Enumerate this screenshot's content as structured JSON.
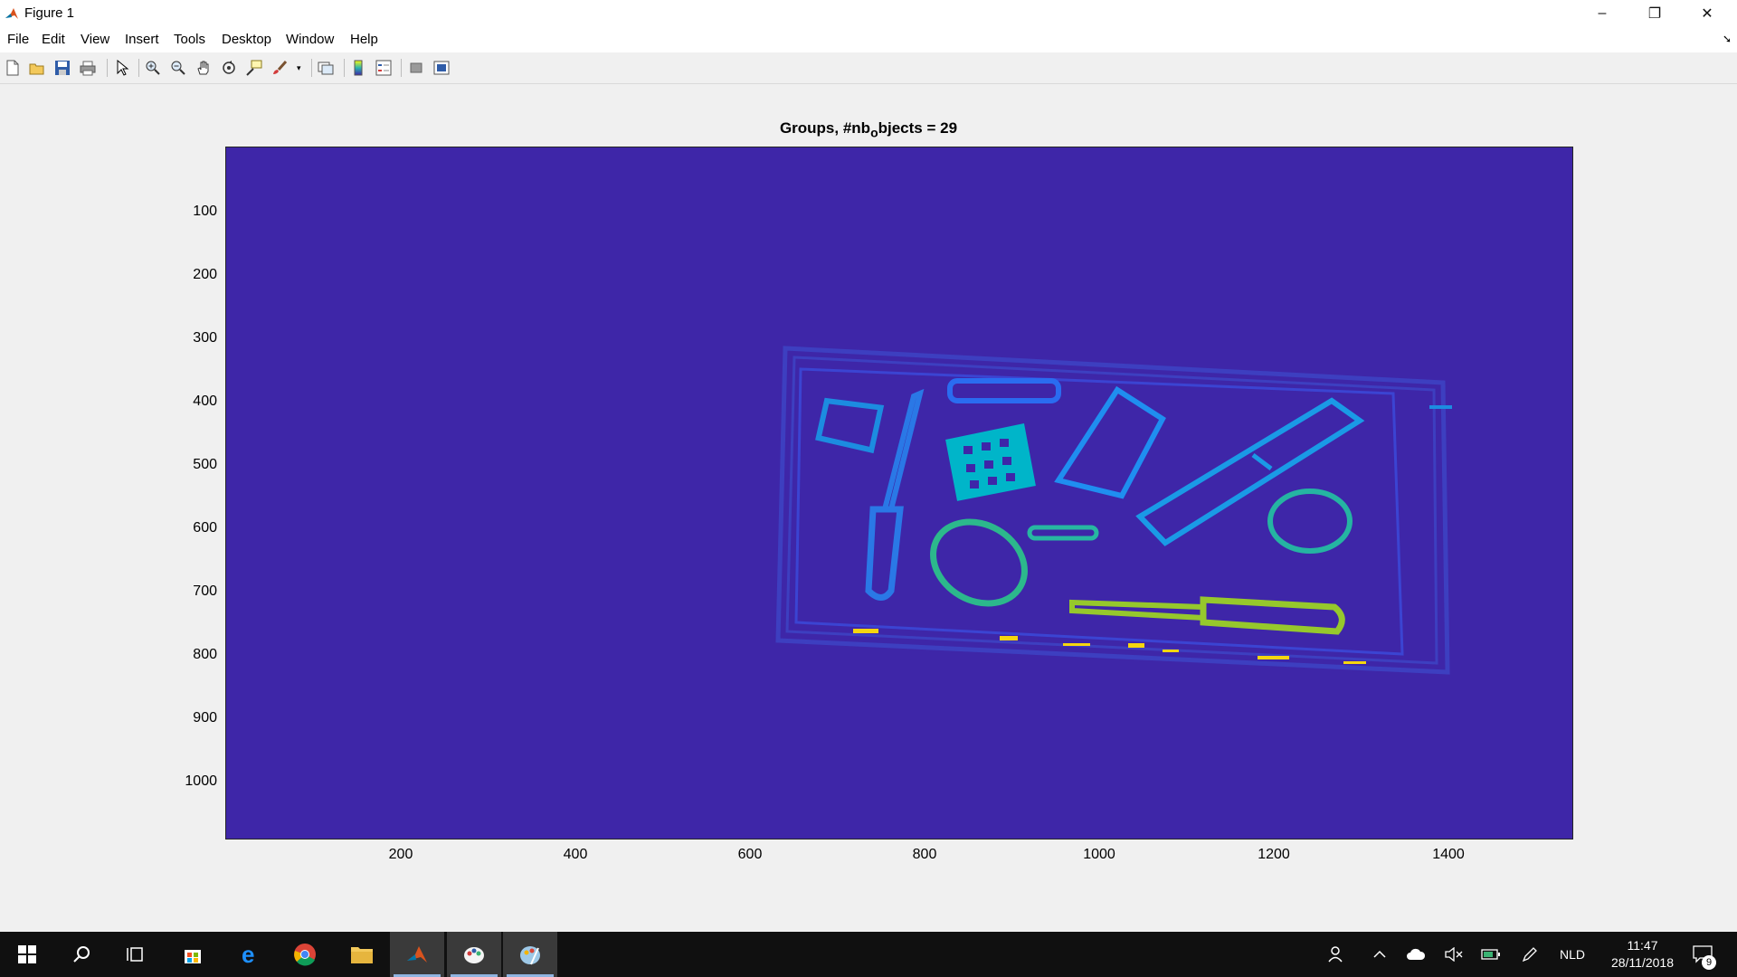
{
  "window": {
    "title": "Figure 1",
    "minimize_glyph": "–",
    "restore_glyph": "❐",
    "close_glyph": "✕"
  },
  "menu": {
    "items": [
      "File",
      "Edit",
      "View",
      "Insert",
      "Tools",
      "Desktop",
      "Window",
      "Help"
    ]
  },
  "toolbar": {
    "icons": [
      "new-figure-icon",
      "open-file-icon",
      "save-icon",
      "print-icon",
      "edit-plot-arrow-icon",
      "zoom-in-icon",
      "zoom-out-icon",
      "pan-hand-icon",
      "rotate-3d-icon",
      "data-cursor-icon",
      "brush-icon",
      "link-plot-icon",
      "colorbar-icon",
      "legend-icon",
      "hide-plot-tools-icon",
      "show-plot-tools-icon"
    ]
  },
  "plot": {
    "title_main": "Groups, #nb",
    "title_sub": "o",
    "title_rest": "bjects = 29",
    "background_color": "#3e26a8",
    "y_ticks": [
      "100",
      "200",
      "300",
      "400",
      "500",
      "600",
      "700",
      "800",
      "900",
      "1000"
    ],
    "x_ticks": [
      "200",
      "400",
      "600",
      "800",
      "1000",
      "1200",
      "1400"
    ],
    "xlim": [
      1,
      1544
    ],
    "ylim": [
      1,
      1088
    ]
  },
  "taskbar": {
    "apps": [
      "start-icon",
      "search-icon",
      "task-view-icon",
      "store-icon",
      "edge-icon",
      "chrome-icon",
      "file-explorer-icon",
      "matlab-icon",
      "paint-icon",
      "paint-3d-icon"
    ],
    "language": "NLD",
    "time": "11:47",
    "date": "28/11/2018",
    "notifications_count": "9"
  }
}
